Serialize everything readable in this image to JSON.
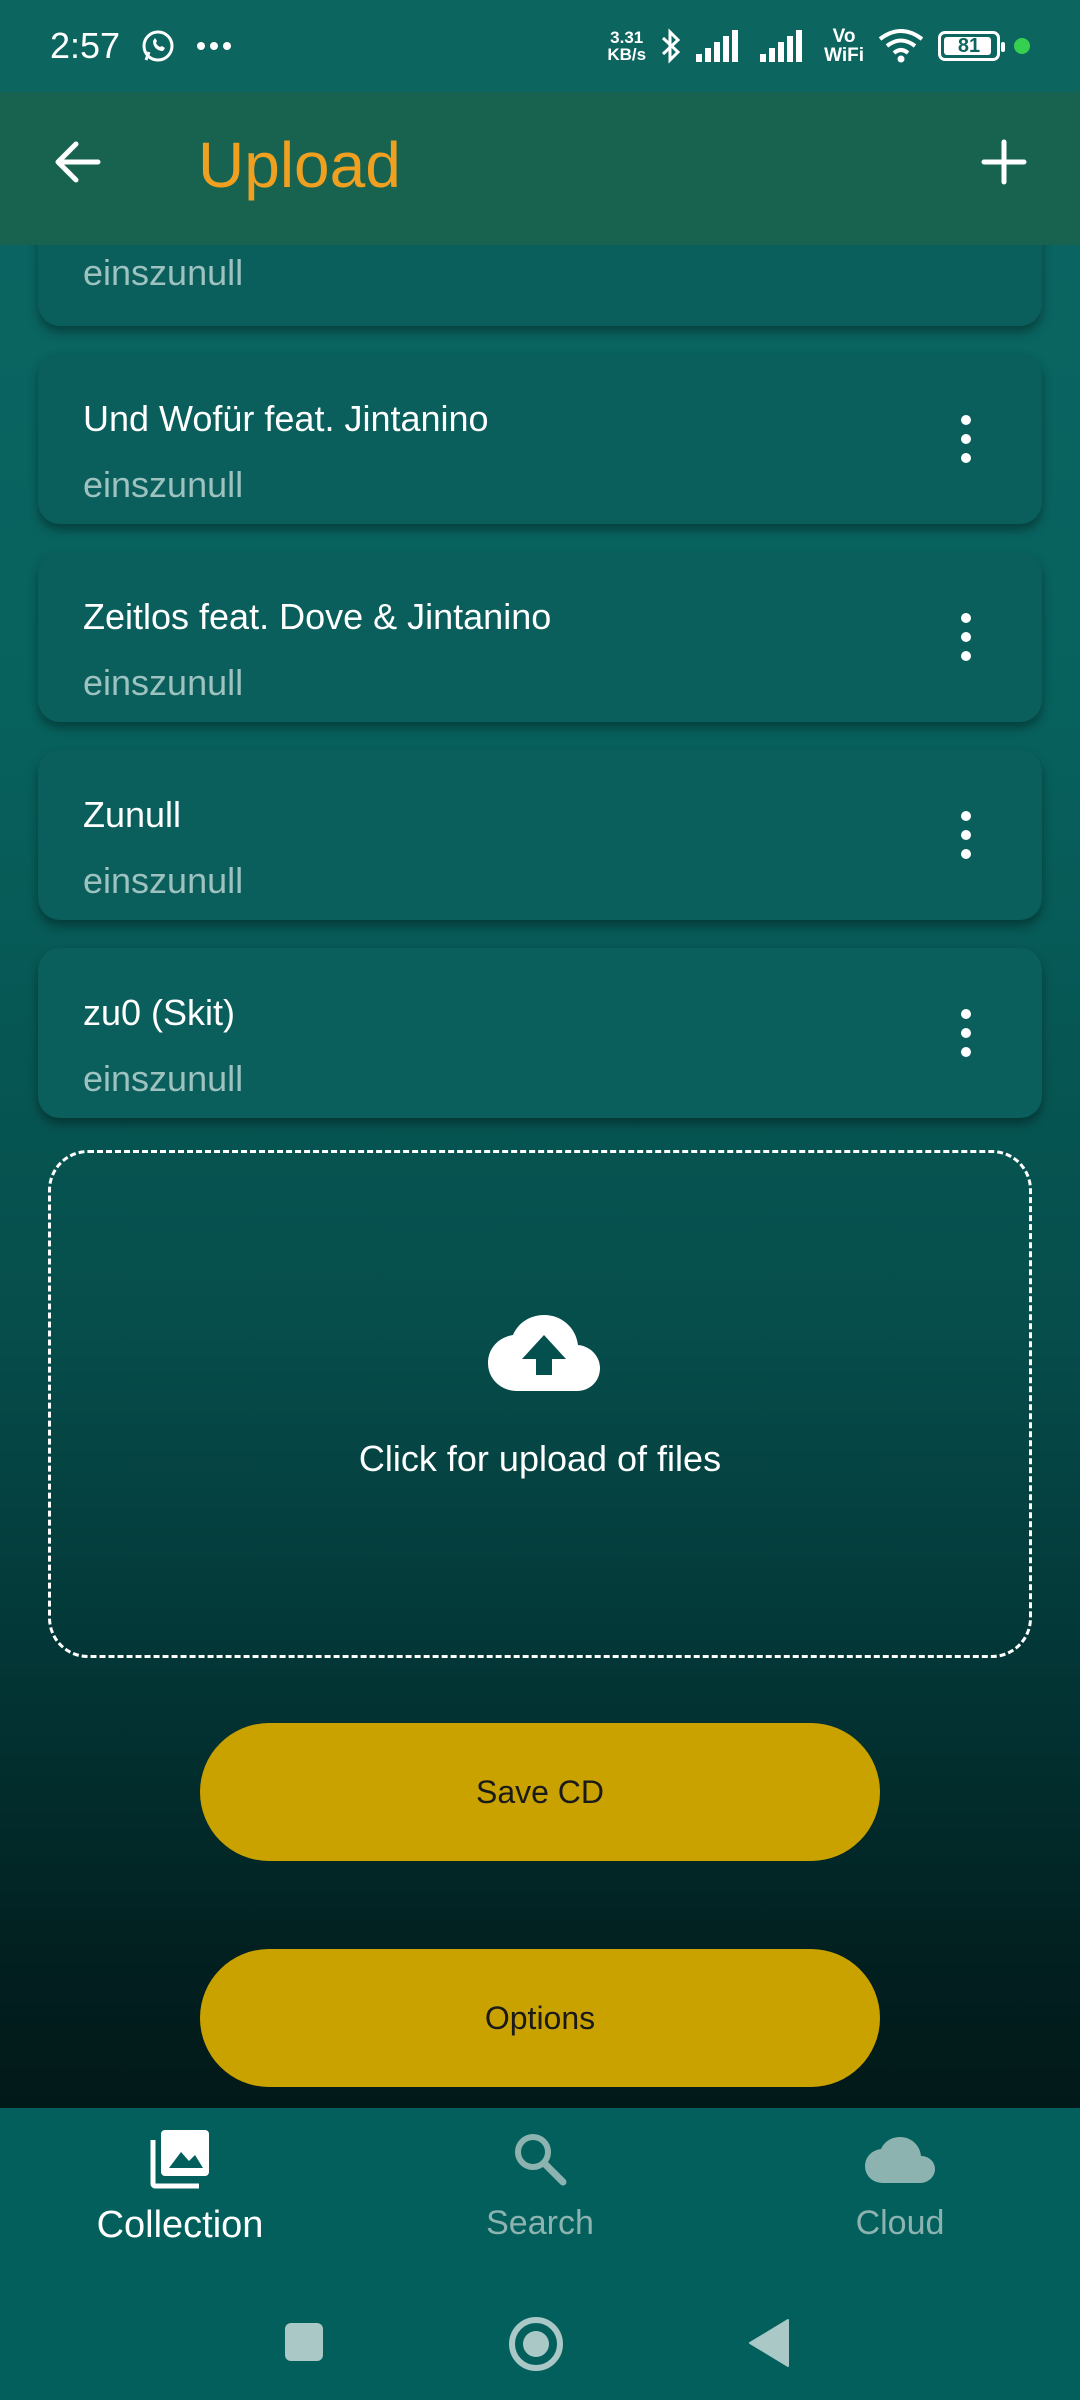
{
  "status_bar": {
    "time": "2:57",
    "net_speed_value": "3.31",
    "net_speed_unit": "KB/s",
    "volte": "Vo",
    "wifi_label": "WiFi",
    "battery": "81"
  },
  "app_bar": {
    "title": "Upload"
  },
  "tracks": [
    {
      "title": "",
      "artist": "einszunull"
    },
    {
      "title": "Und Wofür feat. Jintanino",
      "artist": "einszunull"
    },
    {
      "title": "Zeitlos feat. Dove & Jintanino",
      "artist": "einszunull"
    },
    {
      "title": "Zunull",
      "artist": "einszunull"
    },
    {
      "title": "zu0 (Skit)",
      "artist": "einszunull"
    }
  ],
  "upload": {
    "label": "Click for upload of files"
  },
  "buttons": {
    "save": "Save CD",
    "options": "Options"
  },
  "bottom_nav": {
    "items": [
      {
        "label": "Collection",
        "icon": "image-gallery-icon",
        "active": true
      },
      {
        "label": "Search",
        "icon": "search-icon",
        "active": false
      },
      {
        "label": "Cloud",
        "icon": "cloud-icon",
        "active": false
      }
    ]
  },
  "colors": {
    "title_accent": "#f0a020",
    "button_yellow": "#c9a200",
    "card_bg": "#0a5e5c"
  }
}
